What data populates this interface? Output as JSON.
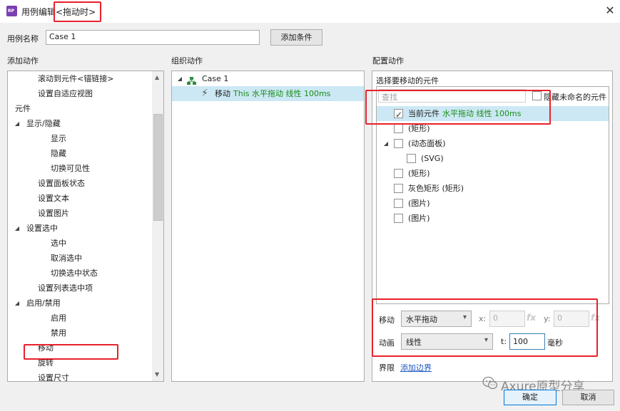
{
  "window": {
    "title_prefix": "用例编辑",
    "title_event": "<拖动时>",
    "close_glyph": "✕"
  },
  "case_name": {
    "label": "用例名称",
    "value": "Case 1",
    "add_condition": "添加条件"
  },
  "add_actions": {
    "header": "添加动作",
    "items": [
      {
        "label": "滚动到元件<锚链接>",
        "arrow": ""
      },
      {
        "label": "设置自适应视图",
        "arrow": ""
      },
      {
        "label": "元件",
        "arrow": "◢"
      },
      {
        "label": "显示/隐藏",
        "arrow": "◢"
      },
      {
        "label": "显示",
        "arrow": ""
      },
      {
        "label": "隐藏",
        "arrow": ""
      },
      {
        "label": "切换可见性",
        "arrow": ""
      },
      {
        "label": "设置面板状态",
        "arrow": ""
      },
      {
        "label": "设置文本",
        "arrow": ""
      },
      {
        "label": "设置图片",
        "arrow": ""
      },
      {
        "label": "设置选中",
        "arrow": "◢"
      },
      {
        "label": "选中",
        "arrow": ""
      },
      {
        "label": "取消选中",
        "arrow": ""
      },
      {
        "label": "切换选中状态",
        "arrow": ""
      },
      {
        "label": "设置列表选中项",
        "arrow": ""
      },
      {
        "label": "启用/禁用",
        "arrow": "◢"
      },
      {
        "label": "启用",
        "arrow": ""
      },
      {
        "label": "禁用",
        "arrow": ""
      },
      {
        "label": "移动",
        "arrow": ""
      },
      {
        "label": "旋转",
        "arrow": ""
      },
      {
        "label": "设置尺寸",
        "arrow": ""
      }
    ]
  },
  "organize_actions": {
    "header": "组织动作",
    "case_label": "Case 1",
    "action_verb": "移动",
    "action_detail": "This 水平拖动 线性 100ms"
  },
  "configure": {
    "header": "配置动作",
    "select_label": "选择要移动的元件",
    "search_placeholder": "查找",
    "hide_unnamed": "隐藏未命名的元件",
    "widgets": [
      {
        "label": "当前元件",
        "detail": "水平拖动 线性 100ms",
        "checked": true,
        "arrow": ""
      },
      {
        "label": "(矩形)",
        "detail": "",
        "checked": false,
        "arrow": ""
      },
      {
        "label": "(动态面板)",
        "detail": "",
        "checked": false,
        "arrow": "◢"
      },
      {
        "label": "(SVG)",
        "detail": "",
        "checked": false,
        "arrow": ""
      },
      {
        "label": "(矩形)",
        "detail": "",
        "checked": false,
        "arrow": ""
      },
      {
        "label": "灰色矩形 (矩形)",
        "detail": "",
        "checked": false,
        "arrow": ""
      },
      {
        "label": "(图片)",
        "detail": "",
        "checked": false,
        "arrow": ""
      },
      {
        "label": "(图片)",
        "detail": "",
        "checked": false,
        "arrow": ""
      }
    ],
    "move_label": "移动",
    "move_value": "水平拖动",
    "x_label": "x:",
    "x_value": "0",
    "y_label": "y:",
    "y_value": "0",
    "fx_glyph": "fx",
    "anim_label": "动画",
    "anim_value": "线性",
    "t_label": "t:",
    "t_value": "100",
    "t_unit": "毫秒",
    "bounds_label": "界限",
    "add_bounds": "添加边界"
  },
  "footer": {
    "ok": "确定",
    "cancel": "取消",
    "watermark": "Axure原型分享"
  },
  "colors": {
    "highlight_red": "#e8212b",
    "selection_blue": "#cce8f4",
    "action_green": "#1a8d1a",
    "link_blue": "#1d57c2"
  }
}
